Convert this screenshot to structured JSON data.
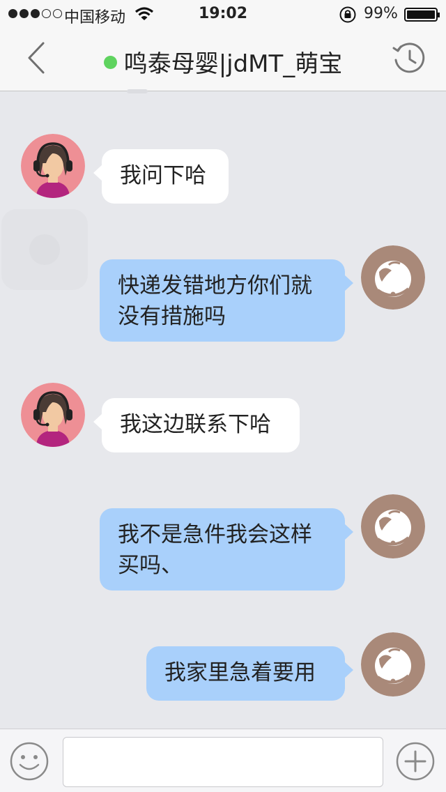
{
  "status_bar": {
    "carrier": "中国移动",
    "time": "19:02",
    "battery": "99%",
    "signal_icon": "signal-dots-icon",
    "wifi_icon": "wifi-icon",
    "lock_icon": "orientation-lock-icon",
    "battery_icon": "battery-icon"
  },
  "nav": {
    "title": "鸣泰母婴|jdMT_萌宝",
    "online_color": "#5fd35f",
    "back_icon": "chevron-left-icon",
    "history_icon": "history-clock-icon"
  },
  "messages": [
    {
      "side": "left",
      "sender": "agent",
      "text": "我问下哈"
    },
    {
      "side": "right",
      "sender": "customer",
      "text": "快递发错地方你们就没有措施吗"
    },
    {
      "side": "left",
      "sender": "agent",
      "text": "我这边联系下哈"
    },
    {
      "side": "right",
      "sender": "customer",
      "text": "我不是急件我会这样买吗、"
    },
    {
      "side": "right",
      "sender": "customer",
      "text": "我家里急着要用"
    }
  ],
  "input": {
    "value": "",
    "emoji_icon": "emoji-smile-icon",
    "plus_icon": "plus-circle-icon"
  },
  "colors": {
    "background": "#e7e8ec",
    "right_bubble": "#a9d0fb",
    "left_bubble": "#ffffff",
    "customer_avatar": "#a98979",
    "agent_avatar": "#ee8f95"
  }
}
